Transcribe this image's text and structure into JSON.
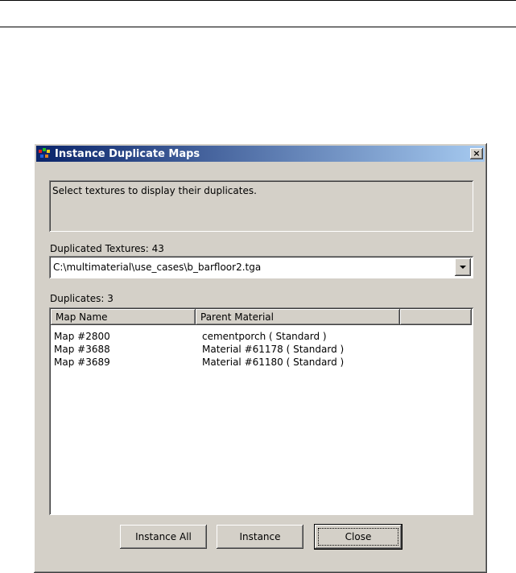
{
  "dialog": {
    "title": "Instance Duplicate Maps",
    "close_glyph": "×",
    "info_text": "Select textures to display their duplicates.",
    "duplicated_textures_label": "Duplicated Textures: 43",
    "selected_texture": "C:\\multimaterial\\use_cases\\b_barfloor2.tga",
    "duplicates_label": "Duplicates: 3",
    "columns": [
      "Map Name",
      "Parent Material"
    ],
    "rows": [
      {
        "map_name": "Map #2800",
        "parent_material": "cementporch  ( Standard )"
      },
      {
        "map_name": "Map #3688",
        "parent_material": "Material #61178  ( Standard )"
      },
      {
        "map_name": "Map #3689",
        "parent_material": "Material #61180  ( Standard )"
      }
    ],
    "buttons": {
      "instance_all": "Instance All",
      "instance": "Instance",
      "close": "Close"
    }
  },
  "colors": {
    "title_gradient_start": "#0a246a",
    "title_gradient_end": "#a6caf0",
    "face": "#d4d0c8"
  },
  "icons": {
    "app": "3dsmax-app-icon",
    "close": "close-icon",
    "dropdown": "chevron-down-icon"
  }
}
